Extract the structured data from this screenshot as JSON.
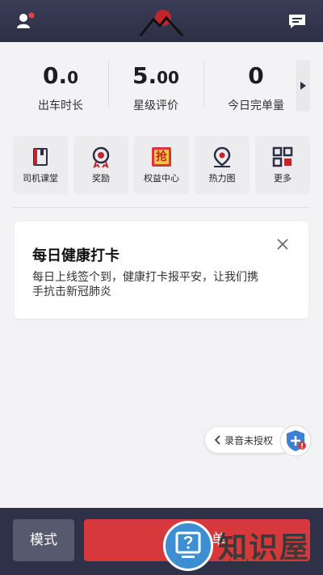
{
  "header": {
    "profile_icon": "user-notification-icon",
    "logo_icon": "mountain-sun-logo",
    "message_icon": "message-icon"
  },
  "stats": [
    {
      "value_main": "0.",
      "value_small": "0",
      "label": "出车时长"
    },
    {
      "value_main": "5.",
      "value_small": "00",
      "label": "星级评价"
    },
    {
      "value_main": "0",
      "value_small": "",
      "label": "今日完单量"
    }
  ],
  "tiles": [
    {
      "label": "司机课堂",
      "icon": "book-icon"
    },
    {
      "label": "奖励",
      "icon": "medal-icon"
    },
    {
      "label": "权益中心",
      "icon": "grab-icon",
      "icon_text": "抢"
    },
    {
      "label": "热力图",
      "icon": "map-pin-icon"
    },
    {
      "label": "更多",
      "icon": "grid-icon"
    }
  ],
  "card": {
    "title": "每日健康打卡",
    "body": "每日上线签个到，健康打卡报平安，让我们携手抗击新冠肺炎"
  },
  "recording": {
    "label": "录音未授权"
  },
  "bottom": {
    "mode_label": "模式",
    "start_label": "单"
  },
  "watermark": {
    "text": "知识屋",
    "url": "zhishiwu.com"
  },
  "colors": {
    "header": "#2c2f45",
    "accent_red": "#d6383b",
    "shield_blue": "#3d7fd1"
  }
}
